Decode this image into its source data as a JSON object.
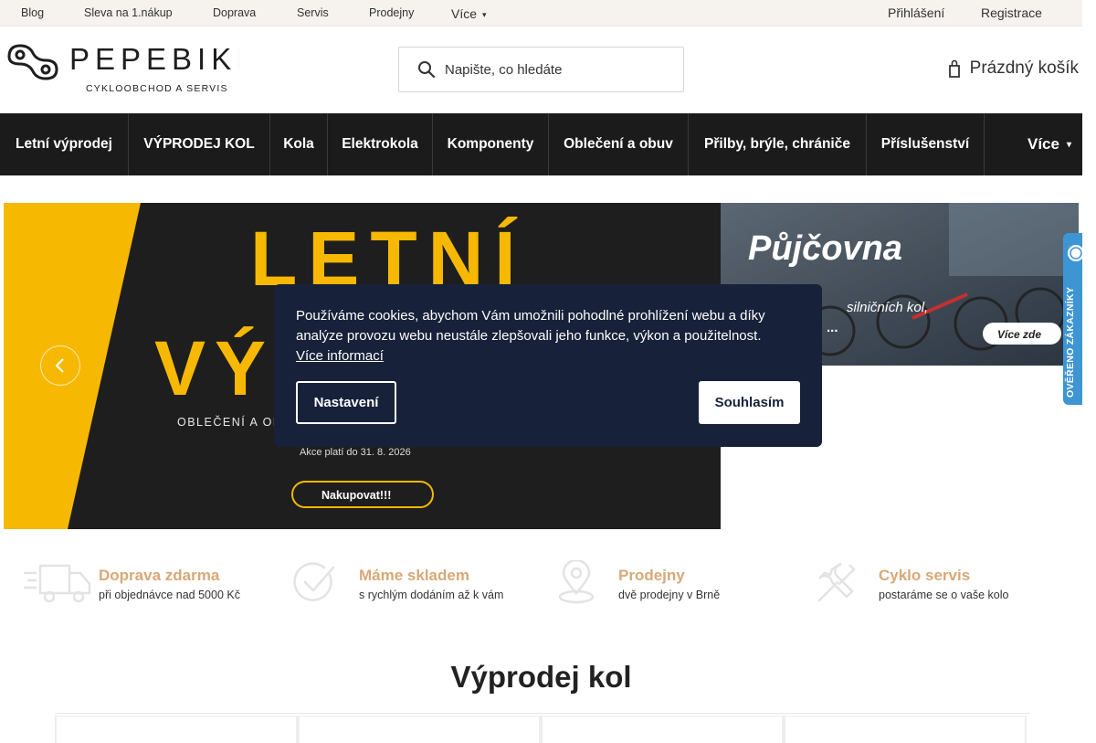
{
  "topbar": {
    "links": [
      "Blog",
      "Sleva na 1.nákup",
      "Doprava",
      "Servis",
      "Prodejny"
    ],
    "more_label": "Více",
    "more_icon": "chevron-down-icon",
    "login": "Přihlášení",
    "register": "Registrace"
  },
  "header": {
    "logo_text": "PEPEBIKE",
    "logo_tagline": "CYKLOOBCHOD A SERVIS",
    "search_placeholder": "Napište, co hledáte",
    "cart_label": "Prázdný košík"
  },
  "nav": {
    "items": [
      "Letní výprodej",
      "VÝPRODEJ KOL",
      "Kola",
      "Elektrokola",
      "Komponenty",
      "Oblečení a obuv",
      "Přilby, brýle, chrániče",
      "Příslušenství"
    ],
    "more_label": "Více"
  },
  "banner": {
    "headline_line1": "LETNÍ",
    "headline_line2": "VÝPRODEJ",
    "subtitle": "OBLEČENÍ A OBUV",
    "validity": "Akce platí do 31. 8. 2026",
    "cta": "Nakupovat!!!",
    "colors": {
      "yellow": "#f6b800",
      "dark": "#1e1e1e"
    }
  },
  "side_banner": {
    "title": "Půjčovna",
    "subtitle": "silničních kol,",
    "subtitle2": "...",
    "cta": "Více zde"
  },
  "verified_badge": {
    "text": "OVĚŘENO ZÁKAZNÍKY",
    "color": "#3d96d3"
  },
  "cookie": {
    "text": "Používáme cookies, abychom Vám umožnili pohodlné prohlížení webu a díky analýze provozu webu neustále zlepšovali jeho funkce, výkon a použitelnost.",
    "more_link": "Více informací",
    "settings_button": "Nastavení",
    "agree_button": "Souhlasím",
    "bg_color": "#17213a"
  },
  "benefits": [
    {
      "icon": "truck-icon",
      "title": "Doprava zdarma",
      "sub": "při objednávce nad 5000 Kč"
    },
    {
      "icon": "checkmark-icon",
      "title": "Máme skladem",
      "sub": "s rychlým dodáním až k vám"
    },
    {
      "icon": "location-pin-icon",
      "title": "Prodejny",
      "sub": "dvě prodejny v Brně"
    },
    {
      "icon": "tools-icon",
      "title": "Cyklo servis",
      "sub": "postaráme se o vaše kolo"
    }
  ],
  "section_title": "Výprodej kol",
  "accent_color": "#d9a877"
}
